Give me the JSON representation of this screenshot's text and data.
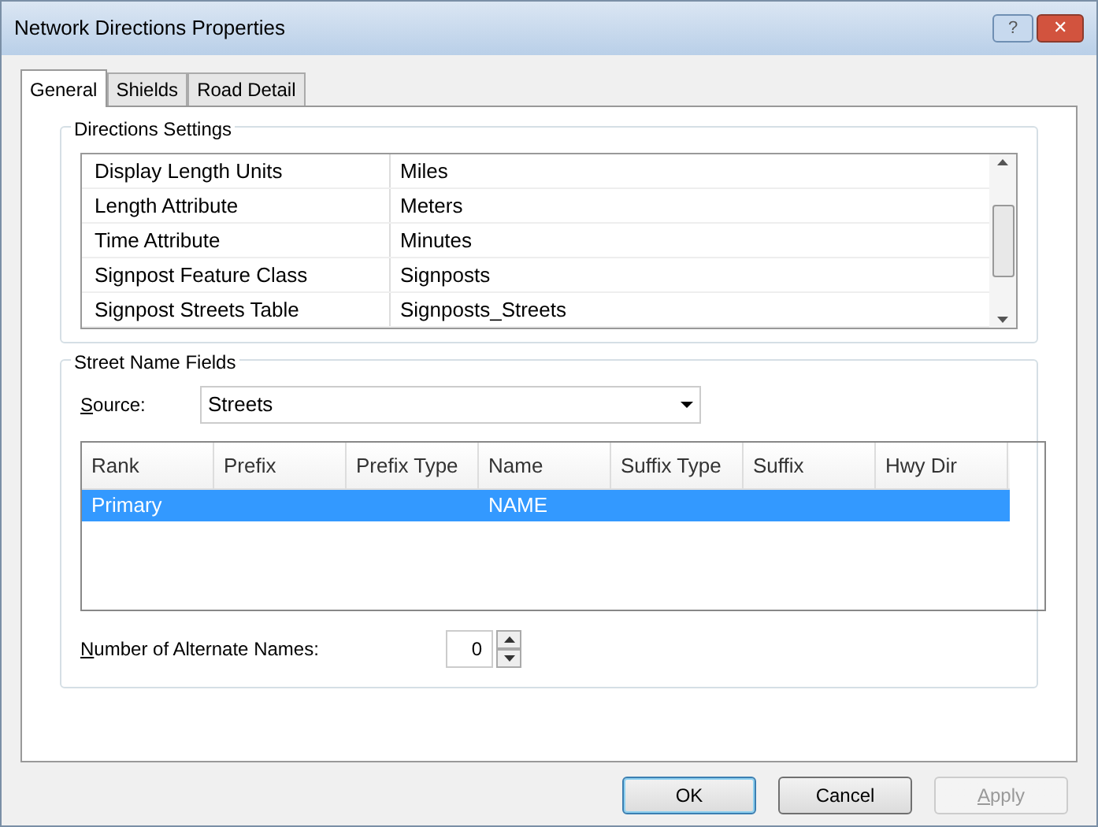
{
  "window": {
    "title": "Network Directions Properties",
    "help_button": "?",
    "close_button": "✕"
  },
  "tabs": [
    {
      "label": "General",
      "selected": true
    },
    {
      "label": "Shields",
      "selected": false
    },
    {
      "label": "Road Detail",
      "selected": false
    }
  ],
  "directions_settings": {
    "title": "Directions Settings",
    "rows": [
      {
        "name": "Display Length Units",
        "value": "Miles"
      },
      {
        "name": "Length Attribute",
        "value": "Meters"
      },
      {
        "name": "Time Attribute",
        "value": "Minutes"
      },
      {
        "name": "Signpost Feature Class",
        "value": "Signposts"
      },
      {
        "name": "Signpost Streets Table",
        "value": "Signposts_Streets"
      }
    ]
  },
  "street_name_fields": {
    "title": "Street Name Fields",
    "source_label": "Source:",
    "source_value": "Streets",
    "columns": [
      "Rank",
      "Prefix",
      "Prefix Type",
      "Name",
      "Suffix Type",
      "Suffix",
      "Hwy Dir"
    ],
    "rows": [
      {
        "selected": true,
        "cells": [
          "Primary",
          "",
          "",
          "NAME",
          "",
          "",
          ""
        ]
      }
    ],
    "alternate_label": "Number of Alternate Names:",
    "alternate_value": "0"
  },
  "buttons": [
    {
      "label": "OK",
      "default": true,
      "disabled": false
    },
    {
      "label": "Cancel",
      "default": false,
      "disabled": false
    },
    {
      "label": "Apply",
      "default": false,
      "disabled": true
    }
  ]
}
